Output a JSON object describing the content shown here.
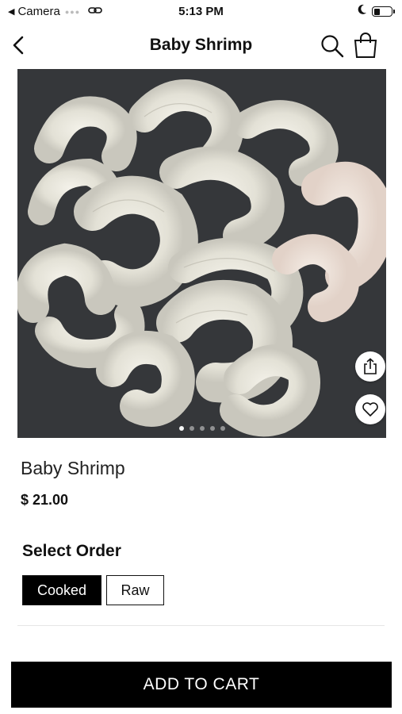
{
  "status_bar": {
    "back_app": "Camera",
    "time": "5:13 PM",
    "battery_level": 0.35
  },
  "nav": {
    "title": "Baby Shrimp",
    "icons": [
      "back-chevron-icon",
      "search-icon",
      "shopping-bag-icon"
    ]
  },
  "gallery": {
    "image": "shrimp-photo",
    "page_count": 5,
    "active_index": 0,
    "actions": [
      "share-icon",
      "heart-icon"
    ]
  },
  "product": {
    "name": "Baby Shrimp",
    "price": "$ 21.00"
  },
  "options": {
    "title": "Select Order",
    "items": [
      {
        "label": "Cooked",
        "selected": true
      },
      {
        "label": "Raw",
        "selected": false
      }
    ]
  },
  "cart_button": "ADD TO CART",
  "colors": {
    "primary": "#000000",
    "background": "#ffffff",
    "photo_background": "#3b3d40",
    "shrimp": "#e8e6dc"
  }
}
